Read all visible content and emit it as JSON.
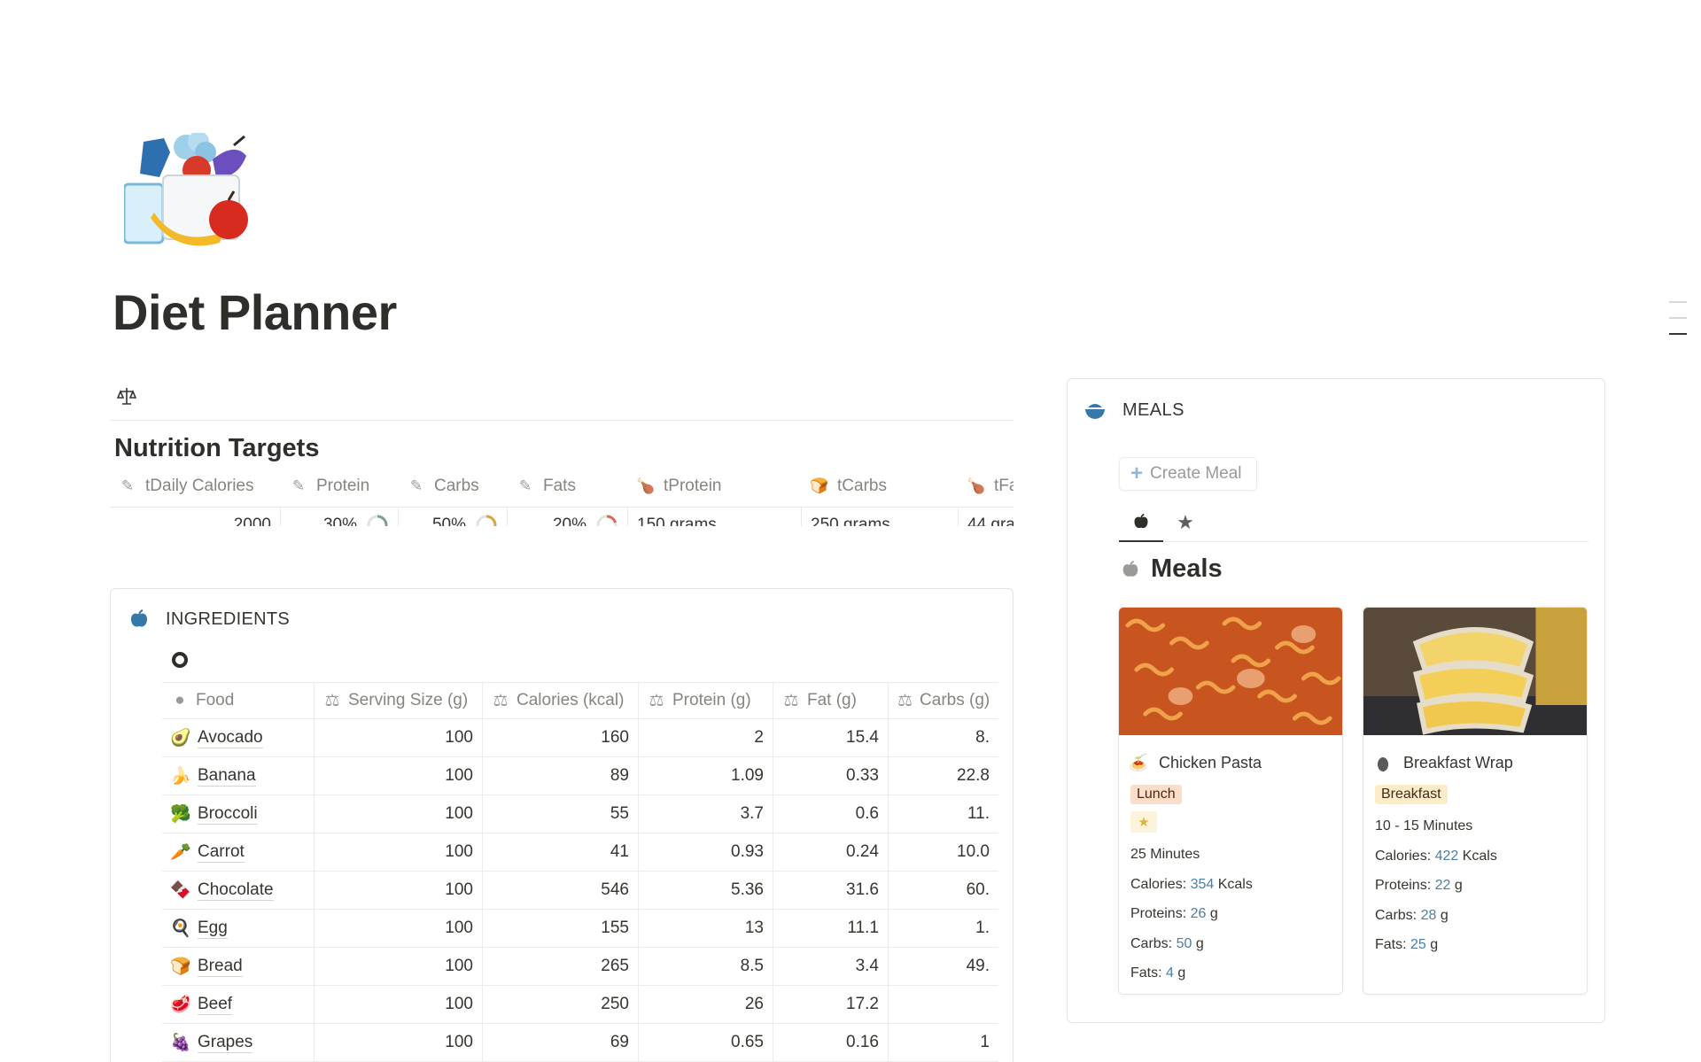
{
  "page": {
    "title": "Diet Planner",
    "icon": "vegetables-bag-icon"
  },
  "nutrition_targets": {
    "title": "Nutrition Targets",
    "columns": [
      {
        "label": "tDaily Calories",
        "icon": "pencil-icon"
      },
      {
        "label": "Protein",
        "icon": "pencil-icon"
      },
      {
        "label": "Carbs",
        "icon": "pencil-icon"
      },
      {
        "label": "Fats",
        "icon": "pencil-icon"
      },
      {
        "label": "tProtein",
        "icon": "drumstick-icon"
      },
      {
        "label": "tCarbs",
        "icon": "bread-icon"
      },
      {
        "label": "tFa",
        "icon": "drumstick-icon"
      }
    ],
    "row": {
      "daily_calories": "2000",
      "protein": "30%",
      "protein_fraction": 0.3,
      "carbs": "50%",
      "carbs_fraction": 0.5,
      "fats": "20%",
      "fats_fraction": 0.2,
      "tprotein": "150 grams",
      "tcarbs": "250 grams",
      "tfats": "44 gra"
    },
    "ring_colors": {
      "protein": "#7f9c8f",
      "carbs": "#d9a441",
      "fats": "#d96a5a",
      "track": "#e3e2df"
    }
  },
  "ingredients": {
    "title": "INGREDIENTS",
    "columns": [
      {
        "label": "Food",
        "icon": "apple-icon"
      },
      {
        "label": "Serving Size (g)",
        "icon": "scale-icon"
      },
      {
        "label": "Calories (kcal)",
        "icon": "scale-icon"
      },
      {
        "label": "Protein (g)",
        "icon": "scale-icon"
      },
      {
        "label": "Fat (g)",
        "icon": "scale-icon"
      },
      {
        "label": "Carbs (g)",
        "icon": "scale-icon"
      }
    ],
    "rows": [
      {
        "emoji": "🥑",
        "food": "Avocado",
        "serving": "100",
        "calories": "160",
        "protein": "2",
        "fat": "15.4",
        "carbs": "8."
      },
      {
        "emoji": "🍌",
        "food": "Banana",
        "serving": "100",
        "calories": "89",
        "protein": "1.09",
        "fat": "0.33",
        "carbs": "22.8"
      },
      {
        "emoji": "🥦",
        "food": "Broccoli",
        "serving": "100",
        "calories": "55",
        "protein": "3.7",
        "fat": "0.6",
        "carbs": "11."
      },
      {
        "emoji": "🥕",
        "food": "Carrot",
        "serving": "100",
        "calories": "41",
        "protein": "0.93",
        "fat": "0.24",
        "carbs": "10.0"
      },
      {
        "emoji": "🍫",
        "food": "Chocolate",
        "serving": "100",
        "calories": "546",
        "protein": "5.36",
        "fat": "31.6",
        "carbs": "60."
      },
      {
        "emoji": "🍳",
        "food": "Egg",
        "serving": "100",
        "calories": "155",
        "protein": "13",
        "fat": "11.1",
        "carbs": "1."
      },
      {
        "emoji": "🍞",
        "food": "Bread",
        "serving": "100",
        "calories": "265",
        "protein": "8.5",
        "fat": "3.4",
        "carbs": "49."
      },
      {
        "emoji": "🥩",
        "food": "Beef",
        "serving": "100",
        "calories": "250",
        "protein": "26",
        "fat": "17.2",
        "carbs": ""
      },
      {
        "emoji": "🍇",
        "food": "Grapes",
        "serving": "100",
        "calories": "69",
        "protein": "0.65",
        "fat": "0.16",
        "carbs": "1"
      }
    ]
  },
  "meals": {
    "title": "MEALS",
    "create_label": "Create Meal",
    "tabs": [
      {
        "icon": "apple-icon",
        "active": true
      },
      {
        "icon": "star-icon",
        "active": false
      }
    ],
    "view_title": "Meals",
    "cards": [
      {
        "title": "Chicken Pasta",
        "icon": "pasta-icon",
        "tag": "Lunch",
        "tag_bg": "#fadec9",
        "starred": true,
        "time": "25 Minutes",
        "calories_label": "Calories: ",
        "calories": "354",
        "calories_unit": " Kcals",
        "proteins_label": "Proteins: ",
        "proteins": "26",
        "proteins_unit": " g",
        "carbs_label": "Carbs: ",
        "carbs": "50",
        "carbs_unit": " g",
        "fats_label": "Fats: ",
        "fats": "4",
        "fats_unit": " g"
      },
      {
        "title": "Breakfast Wrap",
        "icon": "egg-icon",
        "tag": "Breakfast",
        "tag_bg": "#fdecc8",
        "starred": false,
        "time": "10 - 15 Minutes",
        "calories_label": "Calories: ",
        "calories": "422",
        "calories_unit": " Kcals",
        "proteins_label": "Proteins: ",
        "proteins": "22",
        "proteins_unit": " g",
        "carbs_label": "Carbs: ",
        "carbs": "28",
        "carbs_unit": " g",
        "fats_label": "Fats: ",
        "fats": "25",
        "fats_unit": " g"
      }
    ]
  }
}
